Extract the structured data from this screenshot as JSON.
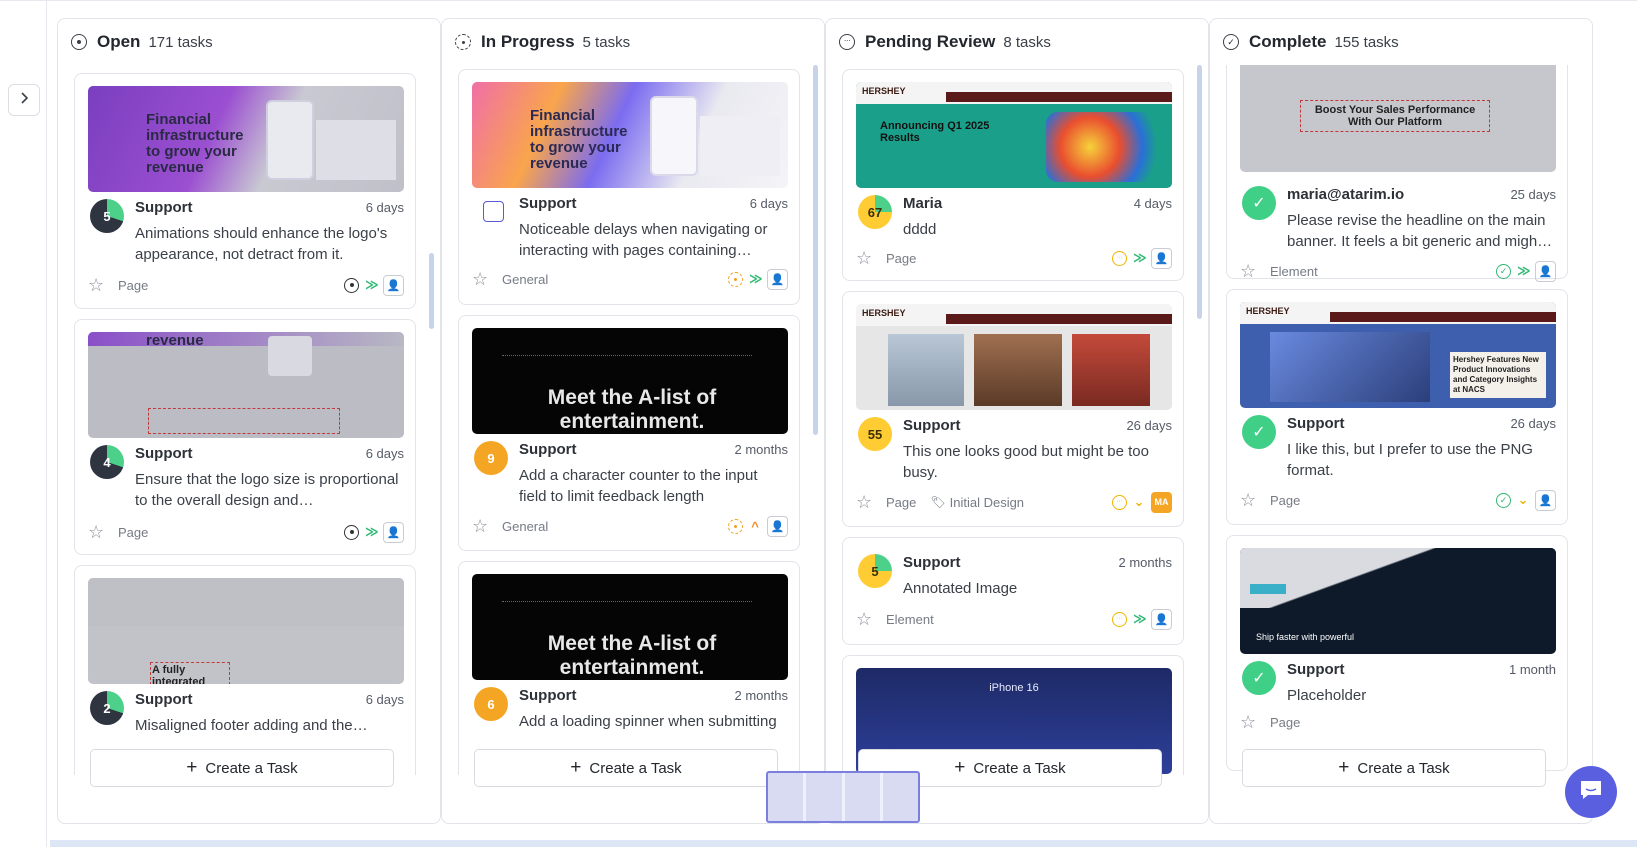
{
  "columns": [
    {
      "title": "Open",
      "count": "171 tasks",
      "cards": [
        {
          "badge": "5",
          "author": "Support",
          "age": "6 days",
          "desc": "Animations should enhance the logo's appearance, not detract from it.",
          "type": "Page"
        },
        {
          "badge": "4",
          "author": "Support",
          "age": "6 days",
          "desc": "Ensure that the logo size is proportional to the overall design and…",
          "type": "Page"
        },
        {
          "badge": "2",
          "author": "Support",
          "age": "6 days",
          "desc": "Misaligned footer adding and the…"
        }
      ]
    },
    {
      "title": "In Progress",
      "count": "5 tasks",
      "cards": [
        {
          "author": "Support",
          "age": "6 days",
          "desc": "Noticeable delays when navigating or interacting with pages containing…",
          "type": "General"
        },
        {
          "badge": "9",
          "author": "Support",
          "age": "2 months",
          "desc": "Add a character counter to the input field to limit feedback length",
          "type": "General"
        },
        {
          "badge": "6",
          "author": "Support",
          "age": "2 months",
          "desc": "Add a loading spinner when submitting"
        }
      ]
    },
    {
      "title": "Pending Review",
      "count": "8 tasks",
      "cards": [
        {
          "badge": "67",
          "author": "Maria",
          "age": "4 days",
          "desc": "dddd",
          "type": "Page"
        },
        {
          "badge": "55",
          "author": "Support",
          "age": "26 days",
          "desc": "This one looks good but might be too busy.",
          "type": "Page",
          "tag": "Initial Design",
          "assignee": "MA"
        },
        {
          "badge": "5",
          "author": "Support",
          "age": "2 months",
          "desc": "Annotated Image",
          "type": "Element"
        }
      ]
    },
    {
      "title": "Complete",
      "count": "155 tasks",
      "cards": [
        {
          "author": "maria@atarim.io",
          "age": "25 days",
          "desc": "Please revise the headline on the main banner. It feels a bit generic and migh…",
          "type": "Element"
        },
        {
          "author": "Support",
          "age": "26 days",
          "desc": "I like this, but I prefer to use the PNG format.",
          "type": "Page"
        },
        {
          "author": "Support",
          "age": "1 month",
          "desc": "Placeholder",
          "type": "Page"
        }
      ]
    }
  ],
  "thumbs": {
    "stripe_headline": "Financial infrastructure to grow your revenue",
    "stripe_revenue": "revenue",
    "stripe_integrated": "A fully integrated",
    "apple_tv": "Meet the A-list of entertainment.",
    "hershey_q1": "Announcing Q1 2025 Results",
    "hershey_brand": "HERSHEY",
    "hershey_booth": "Hershey Features New Product Innovations and Category Insights at NACS",
    "iphone": "iPhone 16",
    "boost": "Boost Your Sales Performance With Our Platform",
    "ship": "Ship faster with powerful"
  },
  "create_label": "Create a Task",
  "colors": {
    "accent": "#5a5fe0",
    "green": "#3fcf86",
    "orange": "#f5a524",
    "yellow": "#ffcc33"
  }
}
